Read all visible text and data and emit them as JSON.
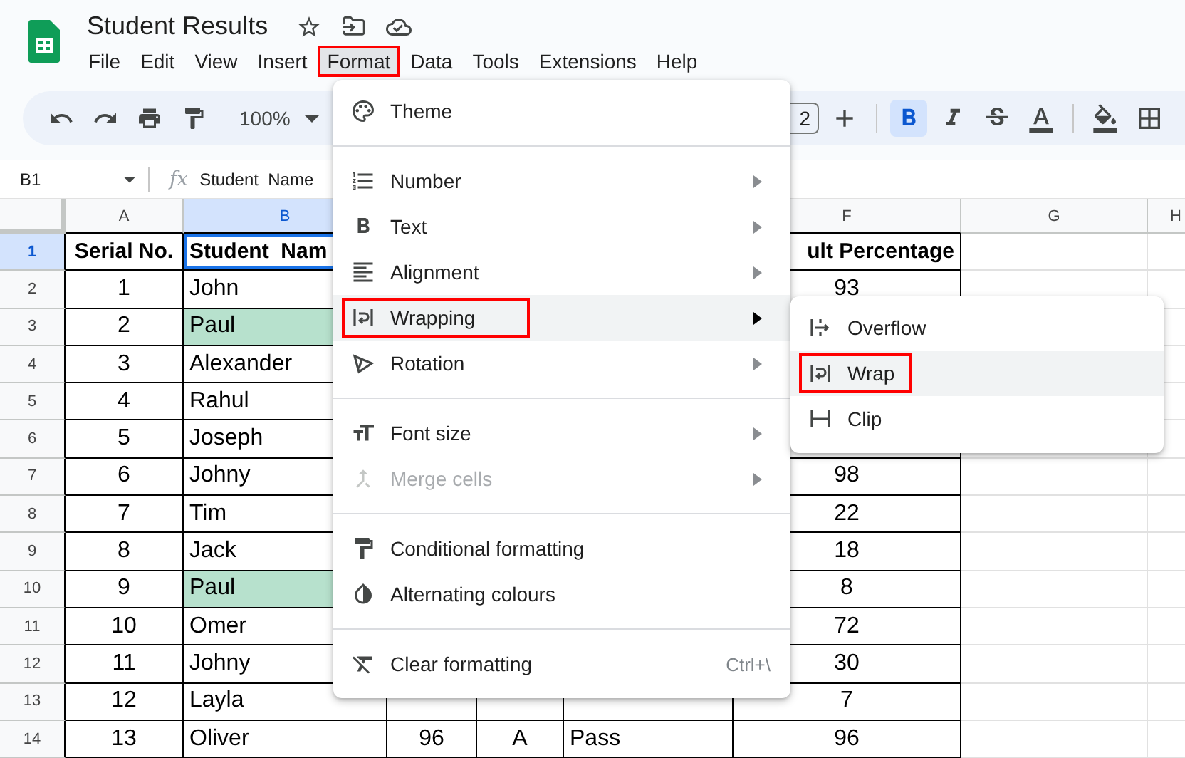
{
  "document": {
    "title": "Student Results"
  },
  "menubar": [
    {
      "label": "File",
      "selected": false,
      "annotated": false
    },
    {
      "label": "Edit",
      "selected": false,
      "annotated": false
    },
    {
      "label": "View",
      "selected": false,
      "annotated": false
    },
    {
      "label": "Insert",
      "selected": false,
      "annotated": false
    },
    {
      "label": "Format",
      "selected": true,
      "annotated": true
    },
    {
      "label": "Data",
      "selected": false,
      "annotated": false
    },
    {
      "label": "Tools",
      "selected": false,
      "annotated": false
    },
    {
      "label": "Extensions",
      "selected": false,
      "annotated": false
    },
    {
      "label": "Help",
      "selected": false,
      "annotated": false
    }
  ],
  "toolbar": {
    "zoom": "100%",
    "font_size": "2",
    "bold_on": true
  },
  "formula_bar": {
    "cell_ref": "B1",
    "fx": "fx",
    "content": "Student  Name"
  },
  "columns": [
    {
      "label": "A",
      "selected": false
    },
    {
      "label": "B",
      "selected": true
    },
    {
      "label": "F",
      "selected": false
    },
    {
      "label": "G",
      "selected": false
    },
    {
      "label": "H",
      "selected": false
    }
  ],
  "rows": [
    {
      "number": "1",
      "selected": true,
      "header": true,
      "highlighted": false,
      "cells": {
        "A": "Serial No.",
        "B": "Student  Nam",
        "F": "ult Percentage"
      }
    },
    {
      "number": "2",
      "selected": false,
      "header": false,
      "highlighted": false,
      "cells": {
        "A": "1",
        "B": "John",
        "F": "93"
      }
    },
    {
      "number": "3",
      "selected": false,
      "header": false,
      "highlighted": true,
      "cells": {
        "A": "2",
        "B": "Paul"
      }
    },
    {
      "number": "4",
      "selected": false,
      "header": false,
      "highlighted": false,
      "cells": {
        "A": "3",
        "B": "Alexander"
      }
    },
    {
      "number": "5",
      "selected": false,
      "header": false,
      "highlighted": false,
      "cells": {
        "A": "4",
        "B": "Rahul"
      }
    },
    {
      "number": "6",
      "selected": false,
      "header": false,
      "highlighted": false,
      "cells": {
        "A": "5",
        "B": "Joseph"
      }
    },
    {
      "number": "7",
      "selected": false,
      "header": false,
      "highlighted": false,
      "cells": {
        "A": "6",
        "B": "Johny",
        "F": "98"
      }
    },
    {
      "number": "8",
      "selected": false,
      "header": false,
      "highlighted": false,
      "cells": {
        "A": "7",
        "B": "Tim",
        "F": "22"
      }
    },
    {
      "number": "9",
      "selected": false,
      "header": false,
      "highlighted": false,
      "cells": {
        "A": "8",
        "B": "Jack",
        "F": "18"
      }
    },
    {
      "number": "10",
      "selected": false,
      "header": false,
      "highlighted": true,
      "cells": {
        "A": "9",
        "B": "Paul",
        "F": "8"
      }
    },
    {
      "number": "11",
      "selected": false,
      "header": false,
      "highlighted": false,
      "cells": {
        "A": "10",
        "B": "Omer",
        "F": "72"
      }
    },
    {
      "number": "12",
      "selected": false,
      "header": false,
      "highlighted": false,
      "cells": {
        "A": "11",
        "B": "Johny",
        "F": "30"
      }
    },
    {
      "number": "13",
      "selected": false,
      "header": false,
      "highlighted": false,
      "cells": {
        "A": "12",
        "B": "Layla",
        "F": "7"
      }
    },
    {
      "number": "14",
      "selected": false,
      "header": false,
      "highlighted": false,
      "cells": {
        "A": "13",
        "B": "Oliver",
        "C": "96",
        "D": "A",
        "E": "Pass",
        "F": "96"
      }
    }
  ],
  "format_menu": {
    "sections": [
      [
        {
          "label": "Theme",
          "has_submenu": false,
          "hovered": false,
          "disabled": false,
          "annotated": false
        }
      ],
      [
        {
          "label": "Number",
          "has_submenu": true,
          "hovered": false,
          "disabled": false,
          "annotated": false
        },
        {
          "label": "Text",
          "has_submenu": true,
          "hovered": false,
          "disabled": false,
          "annotated": false
        },
        {
          "label": "Alignment",
          "has_submenu": true,
          "hovered": false,
          "disabled": false,
          "annotated": false
        },
        {
          "label": "Wrapping",
          "has_submenu": true,
          "hovered": true,
          "disabled": false,
          "annotated": true
        },
        {
          "label": "Rotation",
          "has_submenu": true,
          "hovered": false,
          "disabled": false,
          "annotated": false
        }
      ],
      [
        {
          "label": "Font size",
          "has_submenu": true,
          "hovered": false,
          "disabled": false,
          "annotated": false
        },
        {
          "label": "Merge cells",
          "has_submenu": true,
          "hovered": false,
          "disabled": true,
          "annotated": false
        }
      ],
      [
        {
          "label": "Conditional formatting",
          "has_submenu": false,
          "hovered": false,
          "disabled": false,
          "annotated": false
        },
        {
          "label": "Alternating colours",
          "has_submenu": false,
          "hovered": false,
          "disabled": false,
          "annotated": false
        }
      ],
      [
        {
          "label": "Clear formatting",
          "has_submenu": false,
          "hovered": false,
          "disabled": false,
          "annotated": false,
          "shortcut": "Ctrl+\\"
        }
      ]
    ]
  },
  "wrapping_submenu": [
    {
      "label": "Overflow",
      "hovered": false,
      "annotated": false
    },
    {
      "label": "Wrap",
      "hovered": true,
      "annotated": true
    },
    {
      "label": "Clip",
      "hovered": false,
      "annotated": false
    }
  ]
}
